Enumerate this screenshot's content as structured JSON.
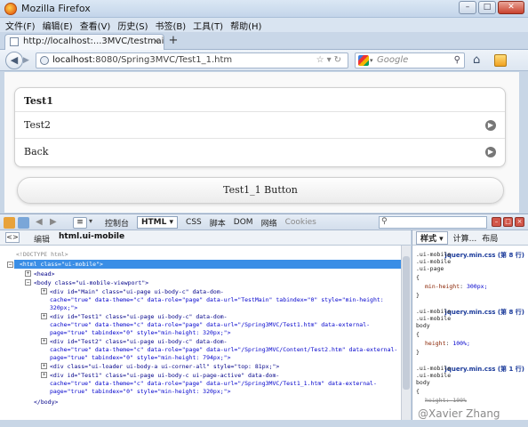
{
  "window": {
    "title": "Mozilla Firefox"
  },
  "menu": [
    "文件(F)",
    "编辑(E)",
    "查看(V)",
    "历史(S)",
    "书签(B)",
    "工具(T)",
    "帮助(H)"
  ],
  "tab": {
    "label": "http://localhost:...3MVC/testmain.htm",
    "newtab": "+"
  },
  "nav": {
    "url_host": "localhost",
    "url_rest": ":8080/Spring3MVC/Test1_1.htm",
    "search_placeholder": "Google"
  },
  "page": {
    "list_header": "Test1",
    "list_items": [
      "Test2",
      "Back"
    ],
    "button": "Test1_1 Button"
  },
  "firebug": {
    "tabs": [
      "控制台",
      "HTML",
      "CSS",
      "脚本",
      "DOM",
      "网络",
      "Cookies"
    ],
    "edit_label": "编辑",
    "breadcrumb_node": "html.ui-mobile",
    "side_tabs": [
      "样式",
      "计算...",
      "布局"
    ]
  },
  "html_lines": [
    "<!DOCTYPE html>",
    "<html class=\"ui-mobile\">",
    "<head>",
    "<body class=\"ui-mobile-viewport\">",
    "<div id=\"Main\" class=\"ui-page ui-body-c\" data-dom-",
    "cache=\"true\" data-theme=\"c\" data-role=\"page\" data-url=\"TestMain\" tabindex=\"0\" style=\"min-height:",
    "320px;\">",
    "<div id=\"Test1\" class=\"ui-page ui-body-c\" data-dom-",
    "cache=\"true\" data-theme=\"c\" data-role=\"page\" data-url=\"/Spring3MVC/Test1.htm\" data-external-",
    "page=\"true\" tabindex=\"0\" style=\"min-height: 320px;\">",
    "<div id=\"Test2\" class=\"ui-page ui-body-c\" data-dom-",
    "cache=\"true\" data-theme=\"c\" data-role=\"page\" data-url=\"/Spring3MVC/Content/Test2.htm\" data-external-",
    "page=\"true\" tabindex=\"0\" style=\"min-height: 794px;\">",
    "<div class=\"ui-loader ui-body-a ui-corner-all\" style=\"top: 81px;\">",
    "<div id=\"Test1\" class=\"ui-page ui-body-c ui-page-active\" data-dom-",
    "cache=\"true\" data-theme=\"c\" data-role=\"page\" data-url=\"/Spring3MVC/Test1_1.htm\" data-external-",
    "page=\"true\" tabindex=\"0\" style=\"min-height: 320px;\">",
    "</body>"
  ],
  "css_panel": {
    "rules": [
      {
        "selector": ".ui-mobile\n.ui-mobile\n.ui-page",
        "source": "jquery.min.css (第 8 行)",
        "prop": "min-height",
        "value": "300px;",
        "overridden": false
      },
      {
        "selector": ".ui-mobile\n.ui-mobile\nbody",
        "source": "jquery.min.css (第 8 行)",
        "prop": "height",
        "value": "100%;",
        "overridden": false
      },
      {
        "selector": ".ui-mobile\n.ui-mobile\nbody",
        "source": "jquery.min.css (第 1 行)",
        "prop": "height",
        "value": "100%",
        "overridden": true
      }
    ]
  },
  "watermark": "@Xavier Zhang"
}
